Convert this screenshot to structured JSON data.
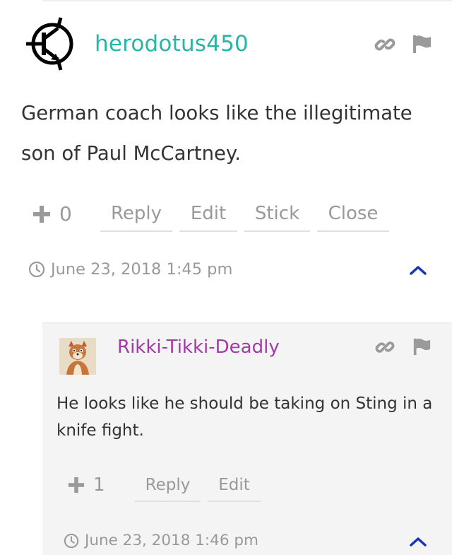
{
  "comments": [
    {
      "author": "herodotus450",
      "avatar_icon": "transistor-icon",
      "text": "German coach looks like the illegitimate son of Paul McCartney.",
      "vote_count": "0",
      "actions": [
        "Reply",
        "Edit",
        "Stick",
        "Close"
      ],
      "date": "June 23, 2018 1:45 pm",
      "author_color": "#2ab5a2"
    },
    {
      "author": "Rikki-Tikki-Deadly",
      "avatar_icon": "cartoon-animal-icon",
      "text": "He looks like he should be taking on Sting in a knife fight.",
      "vote_count": "1",
      "actions": [
        "Reply",
        "Edit"
      ],
      "date": "June 23, 2018 1:46 pm",
      "author_color": "#a23aa8"
    }
  ],
  "colors": {
    "muted": "#999999",
    "text": "#333333",
    "collapse_arrow": "#1a35b0",
    "reply_bg": "#f4f4f4"
  }
}
